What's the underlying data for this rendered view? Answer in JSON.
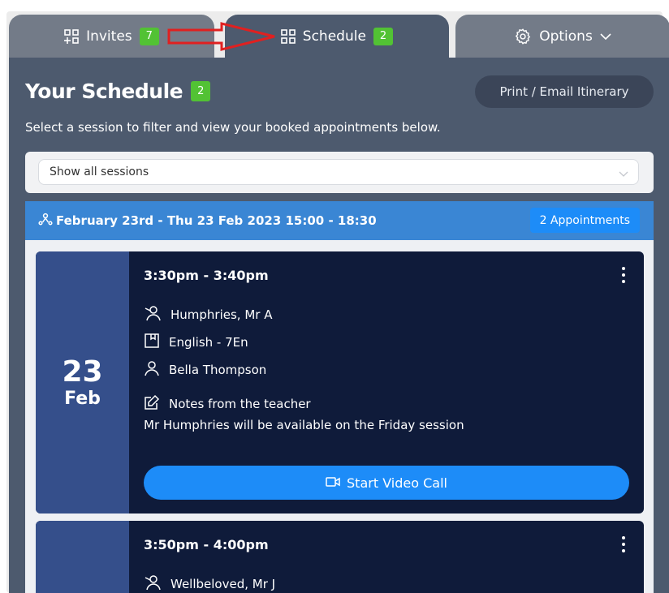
{
  "tabs": [
    {
      "label": "Invites",
      "count": "7",
      "icon": "grid-plus-icon"
    },
    {
      "label": "Schedule",
      "count": "2",
      "icon": "grid-icon"
    },
    {
      "label": "Options",
      "icon": "gear-icon",
      "chevron": "chevron-down-icon"
    }
  ],
  "header": {
    "title": "Your Schedule",
    "count": "2",
    "print_label": "Print / Email Itinerary",
    "subtitle": "Select a session to filter and view your booked appointments below."
  },
  "filter": {
    "selected": "Show all sessions"
  },
  "session": {
    "label": "February 23rd - Thu 23 Feb 2023 15:00 - 18:30",
    "appointments_label": "2 Appointments"
  },
  "appointments": [
    {
      "day": "23",
      "month": "Feb",
      "time": "3:30pm - 3:40pm",
      "teacher": "Humphries, Mr A",
      "subject": "English - 7En",
      "student": "Bella Thompson",
      "notes_label": "Notes from the teacher",
      "notes": "Mr Humphries will be available on the Friday session",
      "video_label": "Start Video Call"
    },
    {
      "time": "3:50pm - 4:00pm",
      "teacher": "Wellbeloved, Mr J"
    }
  ],
  "colors": {
    "tab_inactive": "#737b88",
    "panel": "#4d5a6e",
    "session_header": "#3a86d4",
    "card": "#0f1b3a",
    "date_col": "#354f8b",
    "accent_blue": "#1d8cf8",
    "badge_green": "#52c234",
    "annotation_arrow": "#e02020"
  }
}
